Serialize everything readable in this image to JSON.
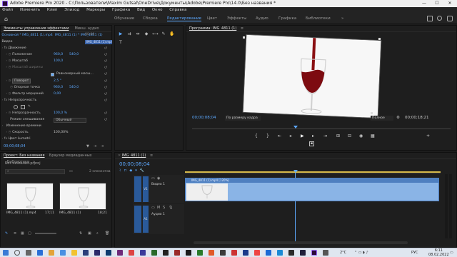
{
  "titlebar": {
    "title": "Adobe Premiere Pro 2020 - C:\\Пользователи\\Maxim Gutsal\\OneDrive\\Документы\\Adobe\\Premiere Pro\\14.0\\Без названия *",
    "minimize": "—",
    "maximize": "☐",
    "close": "✕"
  },
  "menu": [
    "Файл",
    "Изменить",
    "Клип",
    "Эпизод",
    "Маркеры",
    "Графика",
    "Вид",
    "Окно",
    "Справка"
  ],
  "workspaces": {
    "tabs": [
      "Обучение",
      "Сборка",
      "Редактирование",
      "Цвет",
      "Эффекты",
      "Аудио",
      "Графика",
      "Библиотеки"
    ],
    "active_index": 2,
    "more": "»"
  },
  "effect_controls": {
    "tabs": [
      "Элементы управления эффектами",
      "Микш. аудио"
    ],
    "master": "Основной * IMG_4811 (1).mp4",
    "sequence": "IMG_4811 (1) * IMG_4811 (1)",
    "ruler_time": "00:00",
    "clip_label": "IMG_4811 (1).mp4",
    "video_header": "Видео",
    "motion": "Движение",
    "position_label": "Положение",
    "position_x": "960,0",
    "position_y": "540,0",
    "scale_label": "Масштаб",
    "scale_value": "100,0",
    "scale_width_label": "Масштаб ширины",
    "uniform_scale": "Равномерный масш...",
    "rotation_label": "Поворот",
    "rotation_value": "2,5 °",
    "anchor_label": "Опорная точка",
    "anchor_x": "960,0",
    "anchor_y": "540,0",
    "flicker_label": "Фильтр мерцаний",
    "flicker_value": "0,00",
    "opacity": "Непрозрачность",
    "opacity_label": "Непрозрачность",
    "opacity_value": "100,0 %",
    "blend_label": "Режим смешивания",
    "blend_value": "Обычный",
    "time_remap": "Изменение времени",
    "speed_label": "Скорость",
    "speed_value": "100,00%",
    "lumetri": "Цвет Lumetri",
    "timecode": "00;00;08;04"
  },
  "program": {
    "tab": "Программа: IMG_4811 (1)",
    "timecode": "00;00;08;04",
    "fit": "По размеру кадра",
    "quality": "Полное",
    "duration": "00;00;18;21"
  },
  "project": {
    "tabs": [
      "Проект: Без названия",
      "Браузер медиаданных",
      "Библиотеки"
    ],
    "more": "»",
    "file": "Без названия.prproj",
    "count": "2 элементов",
    "items": [
      {
        "name": "IMG_4811 (1).mp4",
        "duration": "17;11"
      },
      {
        "name": "IMG_4811 (1)",
        "duration": "18;21"
      }
    ]
  },
  "timeline": {
    "tab": "IMG_4811 (1)",
    "timecode": "00;00;08;04",
    "tracks": [
      {
        "id": "V1",
        "name": "Видео 1"
      },
      {
        "id": "A1",
        "name": "Аудио 1"
      }
    ],
    "clip_label": "IMG_4811 (1).mp4 [120%]",
    "playhead_fraction": 0.44
  },
  "taskbar": {
    "temp": "2°C",
    "lang": "РУС",
    "time": "6:11",
    "date": "08.02.2022"
  },
  "colors": {
    "accent": "#5da9ff",
    "clip": "#8ab4e6",
    "clip_dark": "#4e7fc0",
    "track_label": "#2a5a9a"
  }
}
